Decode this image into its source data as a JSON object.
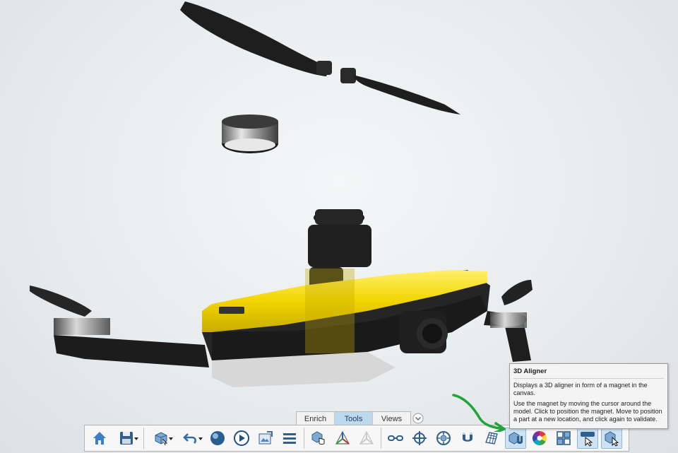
{
  "tabs": [
    {
      "label": "Enrich",
      "active": false
    },
    {
      "label": "Tools",
      "active": true
    },
    {
      "label": "Views",
      "active": false
    }
  ],
  "toolbar": {
    "buttons": [
      {
        "icon": "home-icon"
      },
      {
        "icon": "save-icon",
        "dropdown": true
      },
      {
        "icon": "part-select-icon",
        "dropdown": true
      },
      {
        "icon": "undo-icon",
        "dropdown": true
      },
      {
        "icon": "render-sphere-icon"
      },
      {
        "icon": "play-icon"
      },
      {
        "icon": "export-image-icon"
      },
      {
        "icon": "list-menu-icon"
      },
      {
        "icon": "hand-select-icon"
      },
      {
        "icon": "triad-icon"
      },
      {
        "icon": "triad-disabled-icon",
        "disabled": true
      },
      {
        "icon": "link-chain-icon"
      },
      {
        "icon": "target-icon"
      },
      {
        "icon": "explode-icon"
      },
      {
        "icon": "magnet-icon"
      },
      {
        "icon": "grid-plane-icon"
      },
      {
        "icon": "aligner-3d-icon",
        "highlighted": true
      },
      {
        "icon": "color-wheel-icon"
      },
      {
        "icon": "layout-grid-icon"
      },
      {
        "icon": "pointer-tool-icon",
        "highlighted": true
      },
      {
        "icon": "part-cursor-icon",
        "highlighted": true
      }
    ]
  },
  "tooltip": {
    "title": "3D Aligner",
    "line1": "Displays a 3D aligner in form of a magnet in the canvas.",
    "line2": "Use the magnet by moving the cursor around the model. Click to position the magnet. Move to position a part at a new location, and click again to validate."
  },
  "colors": {
    "accent": "#2a6fb5",
    "active_tab": "#bcd9ee",
    "drone_body": "#f2d500",
    "annotation_arrow": "#1fa53a"
  }
}
